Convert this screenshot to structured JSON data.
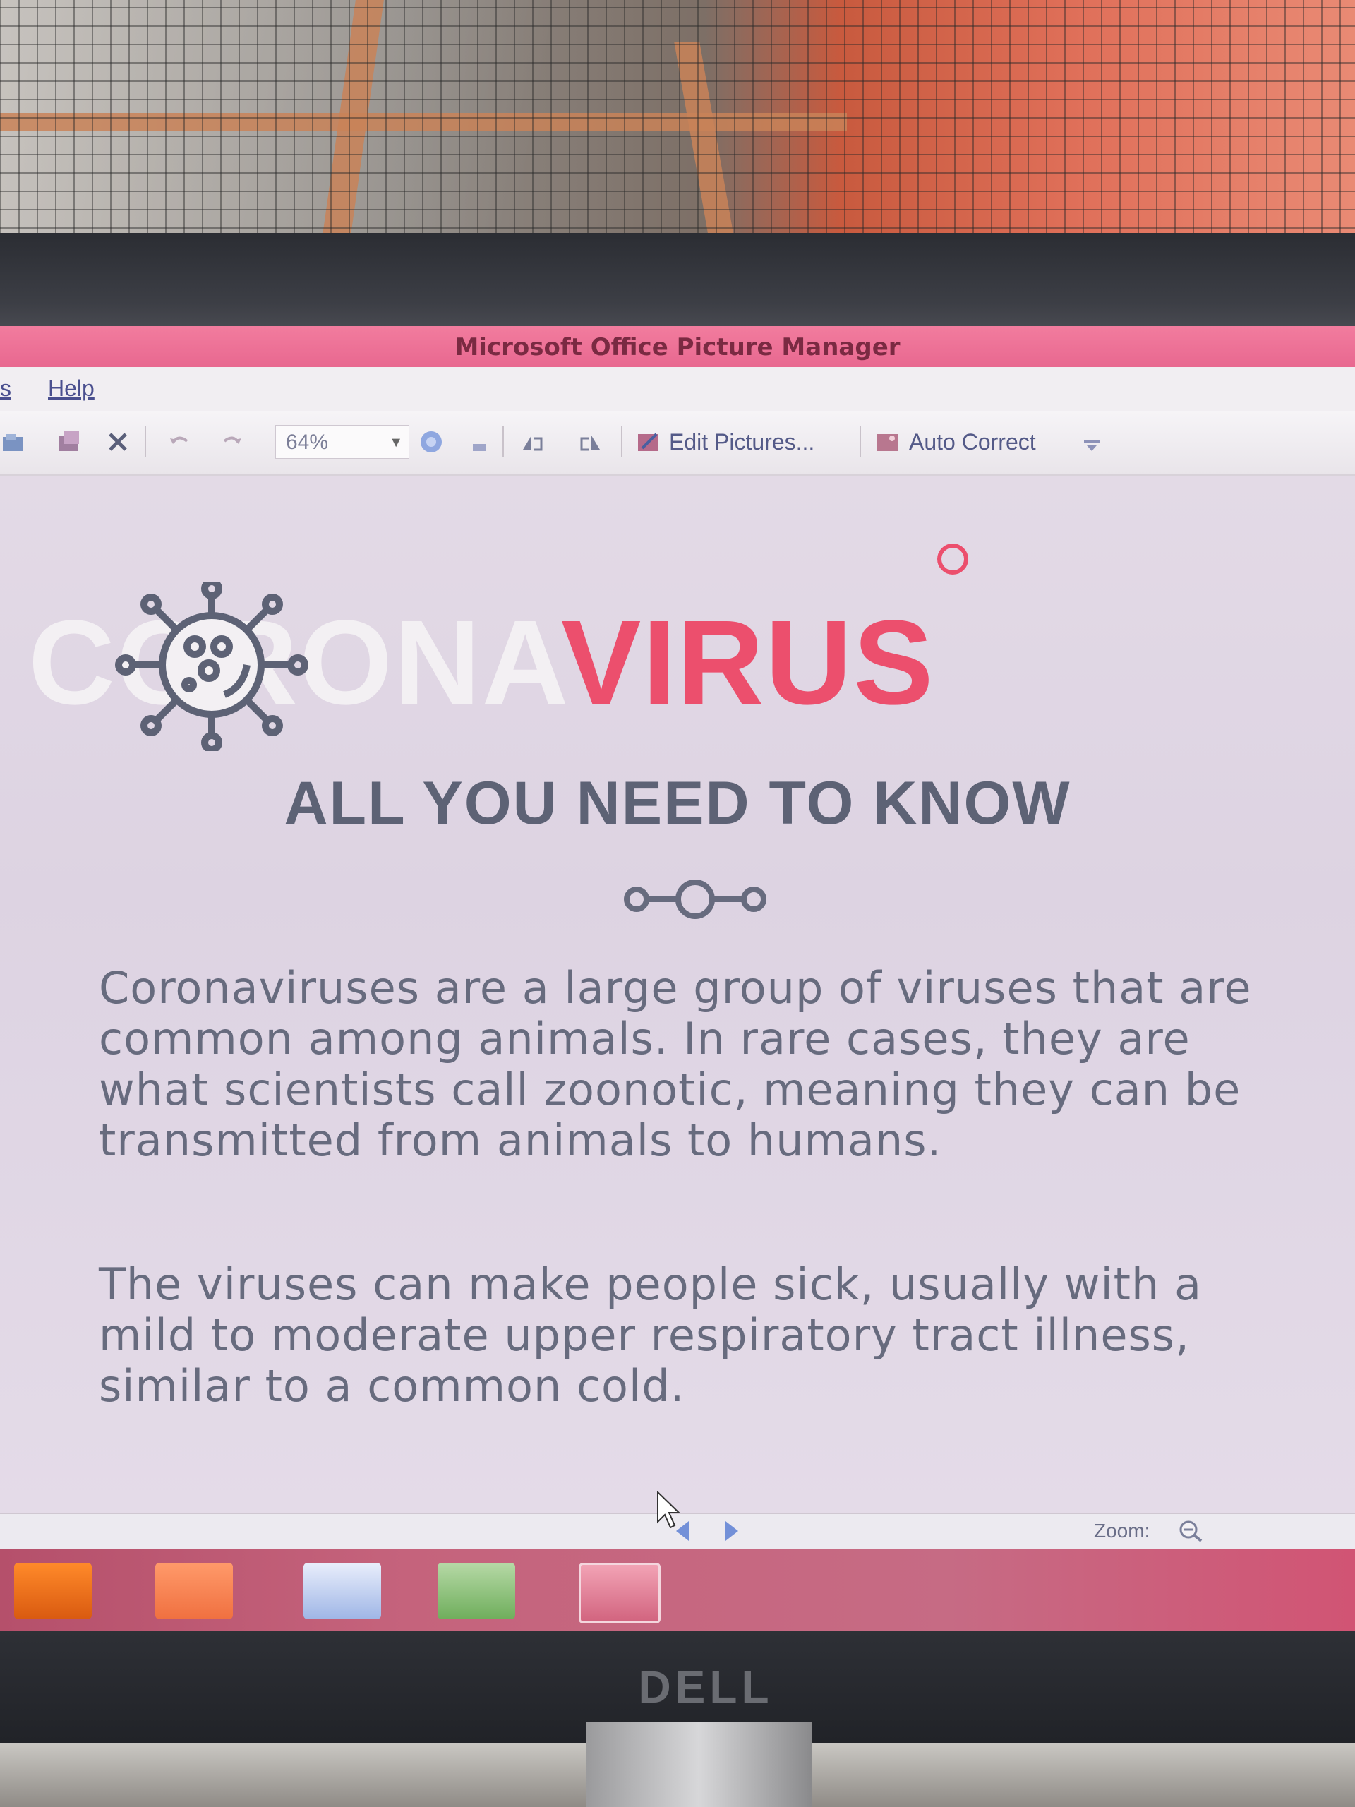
{
  "window": {
    "title": "Microsoft Office Picture Manager"
  },
  "menu": {
    "items": [
      "s",
      "Help"
    ]
  },
  "toolbar": {
    "zoom_value": "64%",
    "edit_pictures_label": "Edit Pictures...",
    "auto_correct_label": "Auto Correct"
  },
  "picture": {
    "headline_part_a": "CORONA",
    "headline_part_b": "VIRUS",
    "subheadline": "ALL YOU NEED TO KNOW",
    "paragraph_1": "Coronaviruses are a large group of viruses that are common among animals. In rare cases, they are what scientists call zoonotic, meaning they can be transmitted from animals to humans.",
    "paragraph_2": "The viruses can make people sick, usually with a mild to moderate upper respiratory tract illness, similar to a common cold."
  },
  "statusbar": {
    "zoom_label": "Zoom:"
  },
  "monitor": {
    "brand": "DELL"
  },
  "colors": {
    "accent_red": "#ec4f6d",
    "headline_gray": "#5d6275",
    "titlebar_pink": "#f27c9e"
  },
  "icons": {
    "taskbar": [
      "vlc-icon",
      "uc-browser-icon",
      "word-icon",
      "app-icon",
      "picture-manager-icon"
    ]
  }
}
